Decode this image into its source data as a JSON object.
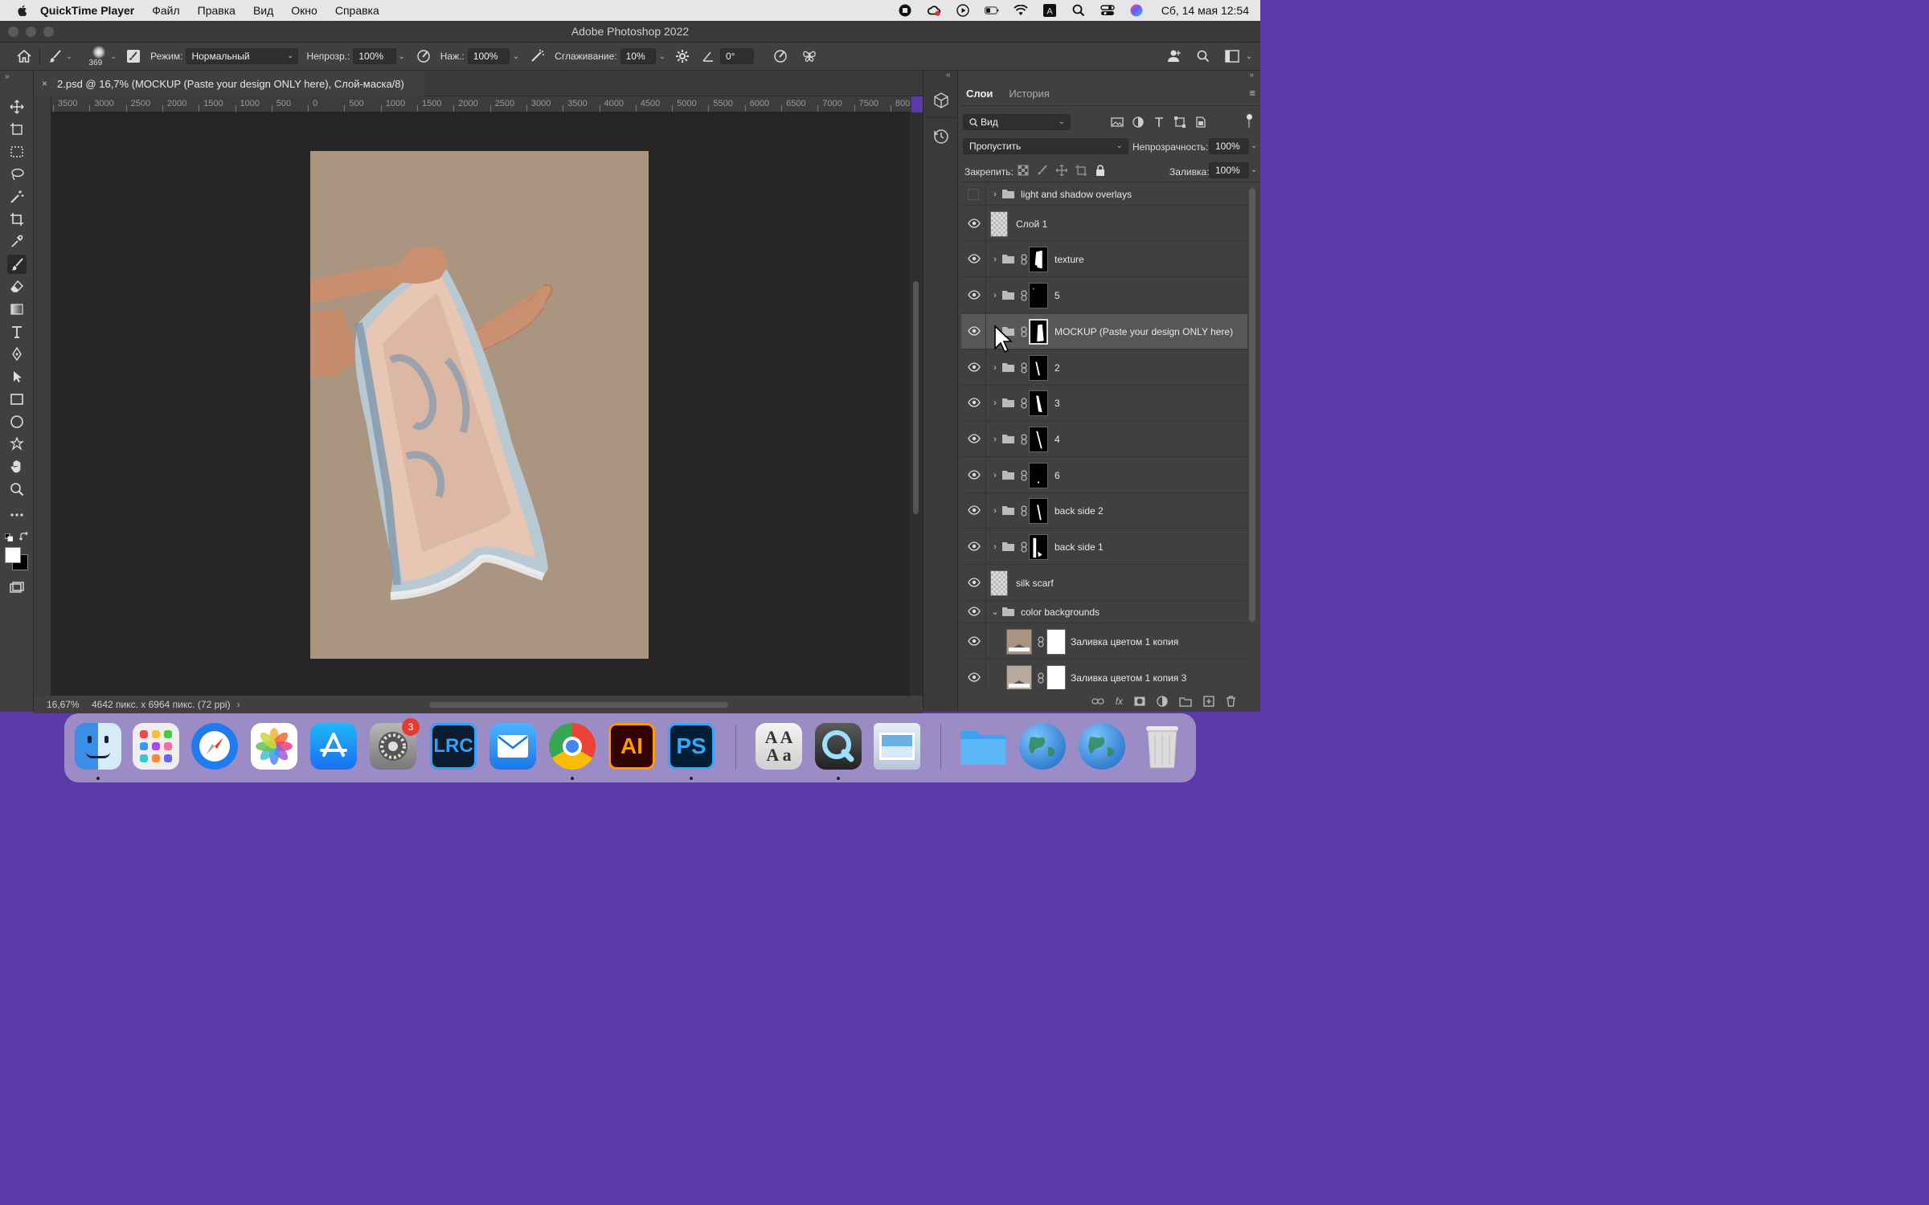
{
  "menubar": {
    "app_name": "QuickTime Player",
    "items": [
      "Файл",
      "Правка",
      "Вид",
      "Окно",
      "Справка"
    ],
    "datetime": "Сб, 14 мая  12:54",
    "icons": [
      "stop-recording-icon",
      "creative-cloud-icon",
      "play-icon",
      "battery-icon",
      "wifi-icon",
      "input-source-icon",
      "spotlight-icon",
      "control-center-icon",
      "siri-icon"
    ]
  },
  "window": {
    "title": "Adobe Photoshop 2022"
  },
  "options": {
    "brush_size": "369",
    "mode_label": "Режим:",
    "mode_value": "Нормальный",
    "opacity_label": "Непрозр.:",
    "opacity_value": "100%",
    "pressure_label": "Наж.:",
    "pressure_value": "100%",
    "smoothing_label": "Сглаживание:",
    "smoothing_value": "10%",
    "angle_value": "0°"
  },
  "document": {
    "tab_title": "2.psd @ 16,7% (MOCKUP (Paste your design ONLY here), Слой-маска/8)",
    "close_glyph": "×",
    "zoom": "16,67%",
    "info": "4642 пикс. x 6964 пикс. (72 ppi)",
    "info_arrow": "›",
    "artboard_color": "#a99580"
  },
  "ruler": {
    "h_labels": [
      "3500",
      "3000",
      "2500",
      "2000",
      "1500",
      "1000",
      "500",
      "0",
      "500",
      "1000",
      "1500",
      "2000",
      "2500",
      "3000",
      "3500",
      "4000",
      "4500",
      "5000",
      "5500",
      "6000",
      "6500",
      "7000",
      "7500",
      "800"
    ]
  },
  "layers_panel": {
    "tabs": [
      "Слои",
      "История"
    ],
    "filter_value": "Вид",
    "blend_value": "Пропустить",
    "opacity_label": "Непрозрачность:",
    "opacity_value": "100%",
    "lock_label": "Закрепить:",
    "fill_label": "Заливка:",
    "fill_value": "100%",
    "layers": [
      {
        "name": "light and shadow overlays",
        "kind": "group",
        "visible": false
      },
      {
        "name": "Слой 1",
        "kind": "pixel",
        "visible": true
      },
      {
        "name": "texture",
        "kind": "group-mask",
        "visible": true
      },
      {
        "name": "5",
        "kind": "group-mask",
        "visible": true
      },
      {
        "name": "MOCKUP (Paste your design ONLY here)",
        "kind": "group-mask",
        "visible": true,
        "selected": true
      },
      {
        "name": "2",
        "kind": "group-mask",
        "visible": true
      },
      {
        "name": "3",
        "kind": "group-mask",
        "visible": true
      },
      {
        "name": "4",
        "kind": "group-mask",
        "visible": true
      },
      {
        "name": "6",
        "kind": "group-mask",
        "visible": true
      },
      {
        "name": "back side 2",
        "kind": "group-mask",
        "visible": true
      },
      {
        "name": "back side 1",
        "kind": "group-mask",
        "visible": true
      },
      {
        "name": "silk scarf",
        "kind": "pixel",
        "visible": true
      },
      {
        "name": "color backgrounds",
        "kind": "group-open",
        "visible": true
      },
      {
        "name": "Заливка цветом 1 копия",
        "kind": "fill",
        "visible": true,
        "color": "#a99580"
      },
      {
        "name": "Заливка цветом 1 копия 3",
        "kind": "fill",
        "visible": true,
        "color": "#b7aa9c"
      }
    ]
  },
  "dock": {
    "apps": [
      {
        "name": "Finder",
        "icon": "finder-icon",
        "running": true
      },
      {
        "name": "Launchpad",
        "icon": "launchpad-icon"
      },
      {
        "name": "Safari",
        "icon": "safari-icon"
      },
      {
        "name": "Photos",
        "icon": "photos-icon"
      },
      {
        "name": "App Store",
        "icon": "app-store-icon"
      },
      {
        "name": "System Preferences",
        "icon": "settings-icon",
        "badge": "3"
      },
      {
        "name": "Lightroom Classic",
        "icon": "lightroom-icon",
        "label": "Lrc"
      },
      {
        "name": "Mail",
        "icon": "mail-icon"
      },
      {
        "name": "Chrome",
        "icon": "chrome-icon",
        "running": true
      },
      {
        "name": "Illustrator",
        "icon": "illustrator-icon",
        "label": "Ai"
      },
      {
        "name": "Photoshop",
        "icon": "photoshop-icon",
        "label": "Ps",
        "running": true
      },
      {
        "name": "Font Book",
        "icon": "font-book-icon",
        "label": "AA"
      },
      {
        "name": "QuickTime Player",
        "icon": "quicktime-icon",
        "running": true
      },
      {
        "name": "Preview",
        "icon": "preview-icon"
      },
      {
        "name": "Downloads",
        "icon": "folder-icon"
      },
      {
        "name": "Network",
        "icon": "globe-icon"
      },
      {
        "name": "Network 2",
        "icon": "globe-icon"
      },
      {
        "name": "Trash",
        "icon": "trash-icon"
      }
    ]
  }
}
